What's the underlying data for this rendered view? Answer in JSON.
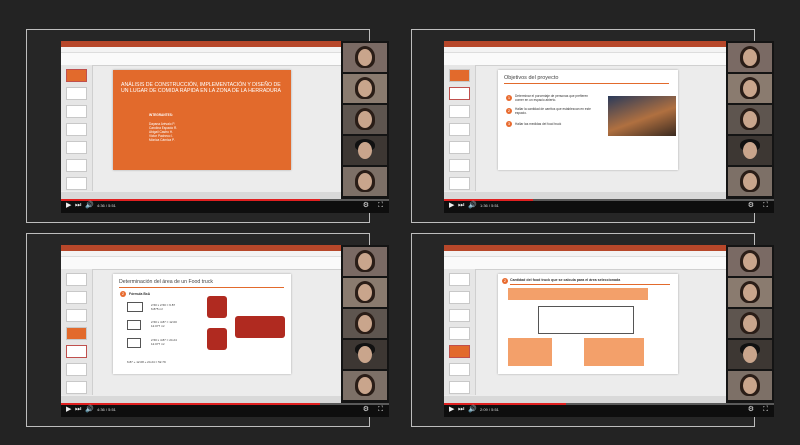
{
  "colors": {
    "accent": "#e26a2c",
    "progress": "#e02020",
    "background": "#232323"
  },
  "icons": {
    "play": "play-icon",
    "next": "next-icon",
    "volume": "volume-icon",
    "settings": "gear-icon",
    "fullscreen": "fullscreen-icon"
  },
  "panels": [
    {
      "time": "4:36 / 5:51",
      "progress": 0.79,
      "slide": {
        "title": "ANÁLISIS DE CONSTRUCCIÓN, IMPLEMENTACIÓN Y DISEÑO DE UN LUGAR DE COMIDA RÁPIDA EN LA ZONA DE LA HERRADURA",
        "members_label": "INTEGRANTES:",
        "members": [
          "Dayana Arévalo P.",
          "Carolina Espacio R.",
          "Abigail Castro H.",
          "Victor Pacheco I.",
          "Mónica Cárnica P."
        ]
      }
    },
    {
      "time": "1:36 / 5:51",
      "progress": 0.27,
      "slide": {
        "title": "Objetivos del proyecto",
        "items": [
          {
            "n": "1",
            "text": "Determinar el porcentaje de personas que prefieren comer en un espacio abierto."
          },
          {
            "n": "2",
            "text": "Hallar la cantidad de carritos que establezcan en este espacio."
          },
          {
            "n": "3",
            "text": "Hallar las medidas del food truck"
          }
        ]
      }
    },
    {
      "time": "4:36 / 5:51",
      "progress": 0.79,
      "slide": {
        "title": "Determinación del área de un Food truck",
        "step": "2",
        "formula_label": "Fórmula BxA",
        "formulas": [
          "2.50 x 2.50 = 6.87\n6.875 m²",
          "2.50 x 4.87 = 12.00\n12.077 m²",
          "2.50 x 4.87 = 24.24\n12.077 m²"
        ],
        "total": "6.87 + 12.08 + 24.24 = 52.79"
      }
    },
    {
      "time": "2:09 / 5:51",
      "progress": 0.37,
      "slide": {
        "title": "Cantidad del food truck que se calcula para el área seleccionada",
        "step": "2"
      }
    }
  ]
}
